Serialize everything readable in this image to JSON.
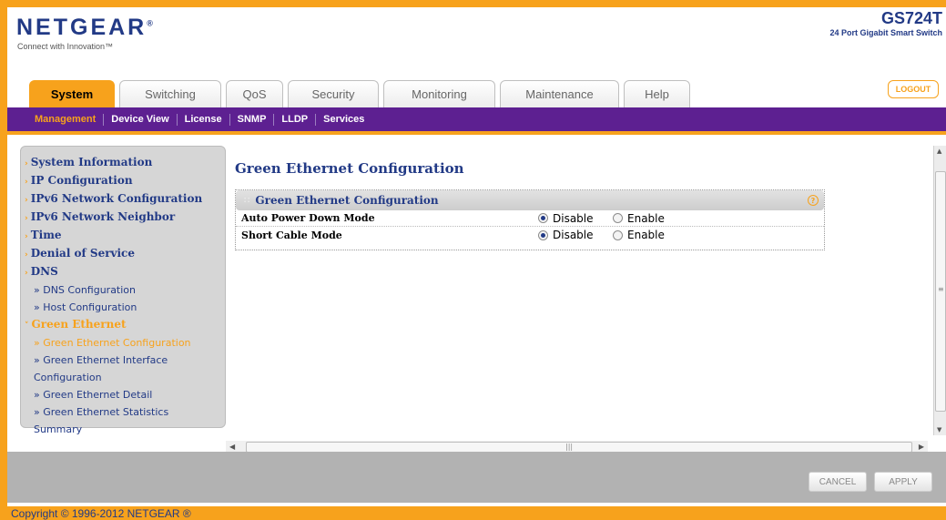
{
  "header": {
    "brand": "NETGEAR",
    "tagline": "Connect with Innovation™",
    "model": "GS724T",
    "model_desc": "24 Port Gigabit Smart Switch",
    "logout_label": "LOGOUT"
  },
  "tabs": [
    {
      "label": "System"
    },
    {
      "label": "Switching"
    },
    {
      "label": "QoS"
    },
    {
      "label": "Security"
    },
    {
      "label": "Monitoring"
    },
    {
      "label": "Maintenance"
    },
    {
      "label": "Help"
    }
  ],
  "subnav": [
    {
      "label": "Management"
    },
    {
      "label": "Device View"
    },
    {
      "label": "License"
    },
    {
      "label": "SNMP"
    },
    {
      "label": "LLDP"
    },
    {
      "label": "Services"
    }
  ],
  "sidebar": {
    "items": [
      {
        "label": "System Information"
      },
      {
        "label": "IP Configuration"
      },
      {
        "label": "IPv6 Network Configuration"
      },
      {
        "label": "IPv6 Network Neighbor"
      },
      {
        "label": "Time"
      },
      {
        "label": "Denial of Service"
      },
      {
        "label": "DNS"
      }
    ],
    "dns_sub": [
      {
        "label": "» DNS Configuration"
      },
      {
        "label": "» Host Configuration"
      }
    ],
    "green_label": "Green Ethernet",
    "green_sub": [
      {
        "label": "» Green Ethernet Configuration"
      },
      {
        "label": "» Green Ethernet Interface",
        "cont": "Configuration"
      },
      {
        "label": "» Green Ethernet Detail"
      },
      {
        "label": "» Green Ethernet Statistics",
        "cont": "Summary"
      }
    ]
  },
  "main": {
    "page_title": "Green Ethernet Configuration",
    "panel_title": "Green Ethernet Configuration",
    "rows": [
      {
        "label": "Auto Power Down Mode",
        "disable": "Disable",
        "enable": "Enable",
        "selected": "Disable"
      },
      {
        "label": "Short Cable Mode",
        "disable": "Disable",
        "enable": "Enable",
        "selected": "Disable"
      }
    ]
  },
  "buttons": {
    "cancel": "CANCEL",
    "apply": "APPLY"
  },
  "footer": {
    "copyright": "Copyright © 1996-2012 NETGEAR ®"
  },
  "colors": {
    "accent_orange": "#f7a21c",
    "nav_purple": "#5d2091",
    "text_blue": "#223a86"
  }
}
